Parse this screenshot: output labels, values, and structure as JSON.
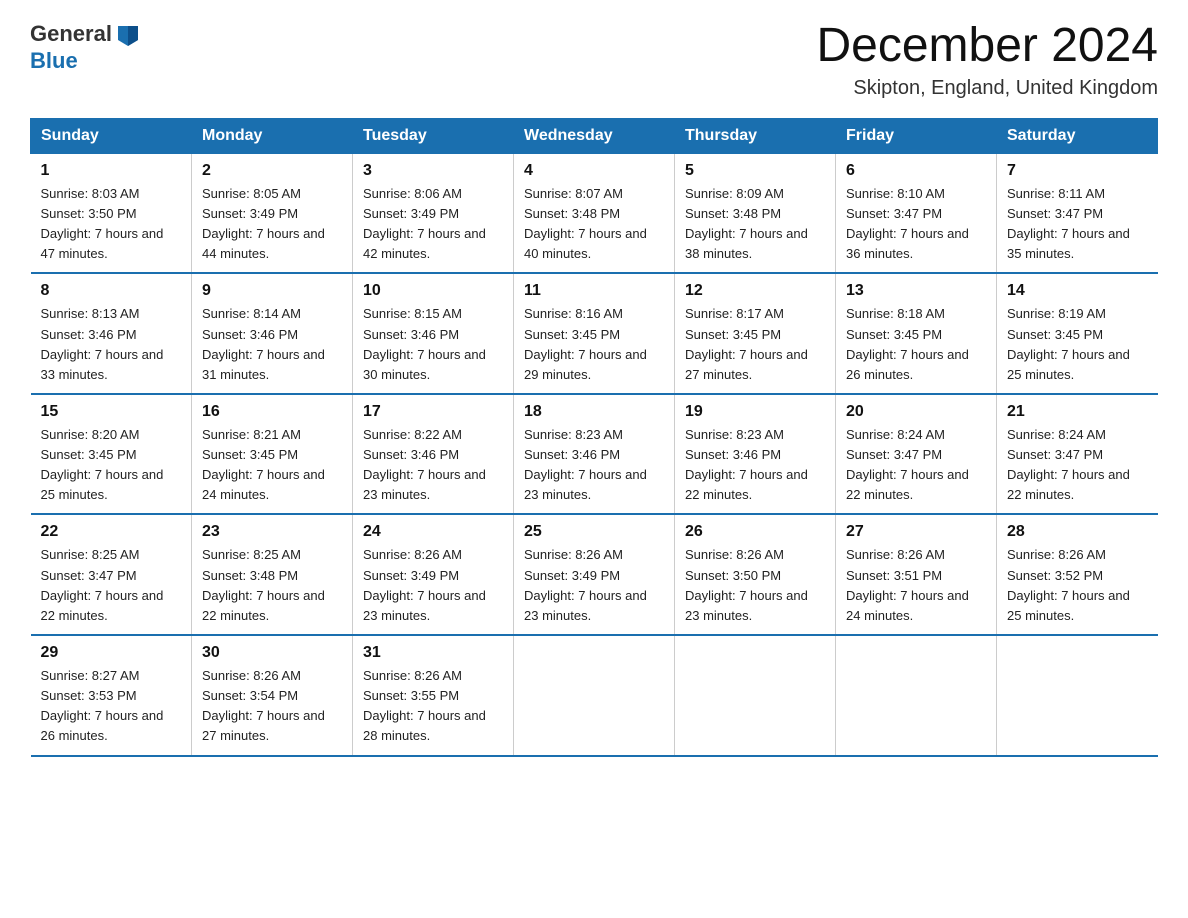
{
  "header": {
    "logo_general": "General",
    "logo_blue": "Blue",
    "month_title": "December 2024",
    "location": "Skipton, England, United Kingdom"
  },
  "days_of_week": [
    "Sunday",
    "Monday",
    "Tuesday",
    "Wednesday",
    "Thursday",
    "Friday",
    "Saturday"
  ],
  "weeks": [
    [
      {
        "day": "1",
        "sunrise": "8:03 AM",
        "sunset": "3:50 PM",
        "daylight": "7 hours and 47 minutes."
      },
      {
        "day": "2",
        "sunrise": "8:05 AM",
        "sunset": "3:49 PM",
        "daylight": "7 hours and 44 minutes."
      },
      {
        "day": "3",
        "sunrise": "8:06 AM",
        "sunset": "3:49 PM",
        "daylight": "7 hours and 42 minutes."
      },
      {
        "day": "4",
        "sunrise": "8:07 AM",
        "sunset": "3:48 PM",
        "daylight": "7 hours and 40 minutes."
      },
      {
        "day": "5",
        "sunrise": "8:09 AM",
        "sunset": "3:48 PM",
        "daylight": "7 hours and 38 minutes."
      },
      {
        "day": "6",
        "sunrise": "8:10 AM",
        "sunset": "3:47 PM",
        "daylight": "7 hours and 36 minutes."
      },
      {
        "day": "7",
        "sunrise": "8:11 AM",
        "sunset": "3:47 PM",
        "daylight": "7 hours and 35 minutes."
      }
    ],
    [
      {
        "day": "8",
        "sunrise": "8:13 AM",
        "sunset": "3:46 PM",
        "daylight": "7 hours and 33 minutes."
      },
      {
        "day": "9",
        "sunrise": "8:14 AM",
        "sunset": "3:46 PM",
        "daylight": "7 hours and 31 minutes."
      },
      {
        "day": "10",
        "sunrise": "8:15 AM",
        "sunset": "3:46 PM",
        "daylight": "7 hours and 30 minutes."
      },
      {
        "day": "11",
        "sunrise": "8:16 AM",
        "sunset": "3:45 PM",
        "daylight": "7 hours and 29 minutes."
      },
      {
        "day": "12",
        "sunrise": "8:17 AM",
        "sunset": "3:45 PM",
        "daylight": "7 hours and 27 minutes."
      },
      {
        "day": "13",
        "sunrise": "8:18 AM",
        "sunset": "3:45 PM",
        "daylight": "7 hours and 26 minutes."
      },
      {
        "day": "14",
        "sunrise": "8:19 AM",
        "sunset": "3:45 PM",
        "daylight": "7 hours and 25 minutes."
      }
    ],
    [
      {
        "day": "15",
        "sunrise": "8:20 AM",
        "sunset": "3:45 PM",
        "daylight": "7 hours and 25 minutes."
      },
      {
        "day": "16",
        "sunrise": "8:21 AM",
        "sunset": "3:45 PM",
        "daylight": "7 hours and 24 minutes."
      },
      {
        "day": "17",
        "sunrise": "8:22 AM",
        "sunset": "3:46 PM",
        "daylight": "7 hours and 23 minutes."
      },
      {
        "day": "18",
        "sunrise": "8:23 AM",
        "sunset": "3:46 PM",
        "daylight": "7 hours and 23 minutes."
      },
      {
        "day": "19",
        "sunrise": "8:23 AM",
        "sunset": "3:46 PM",
        "daylight": "7 hours and 22 minutes."
      },
      {
        "day": "20",
        "sunrise": "8:24 AM",
        "sunset": "3:47 PM",
        "daylight": "7 hours and 22 minutes."
      },
      {
        "day": "21",
        "sunrise": "8:24 AM",
        "sunset": "3:47 PM",
        "daylight": "7 hours and 22 minutes."
      }
    ],
    [
      {
        "day": "22",
        "sunrise": "8:25 AM",
        "sunset": "3:47 PM",
        "daylight": "7 hours and 22 minutes."
      },
      {
        "day": "23",
        "sunrise": "8:25 AM",
        "sunset": "3:48 PM",
        "daylight": "7 hours and 22 minutes."
      },
      {
        "day": "24",
        "sunrise": "8:26 AM",
        "sunset": "3:49 PM",
        "daylight": "7 hours and 23 minutes."
      },
      {
        "day": "25",
        "sunrise": "8:26 AM",
        "sunset": "3:49 PM",
        "daylight": "7 hours and 23 minutes."
      },
      {
        "day": "26",
        "sunrise": "8:26 AM",
        "sunset": "3:50 PM",
        "daylight": "7 hours and 23 minutes."
      },
      {
        "day": "27",
        "sunrise": "8:26 AM",
        "sunset": "3:51 PM",
        "daylight": "7 hours and 24 minutes."
      },
      {
        "day": "28",
        "sunrise": "8:26 AM",
        "sunset": "3:52 PM",
        "daylight": "7 hours and 25 minutes."
      }
    ],
    [
      {
        "day": "29",
        "sunrise": "8:27 AM",
        "sunset": "3:53 PM",
        "daylight": "7 hours and 26 minutes."
      },
      {
        "day": "30",
        "sunrise": "8:26 AM",
        "sunset": "3:54 PM",
        "daylight": "7 hours and 27 minutes."
      },
      {
        "day": "31",
        "sunrise": "8:26 AM",
        "sunset": "3:55 PM",
        "daylight": "7 hours and 28 minutes."
      },
      null,
      null,
      null,
      null
    ]
  ]
}
